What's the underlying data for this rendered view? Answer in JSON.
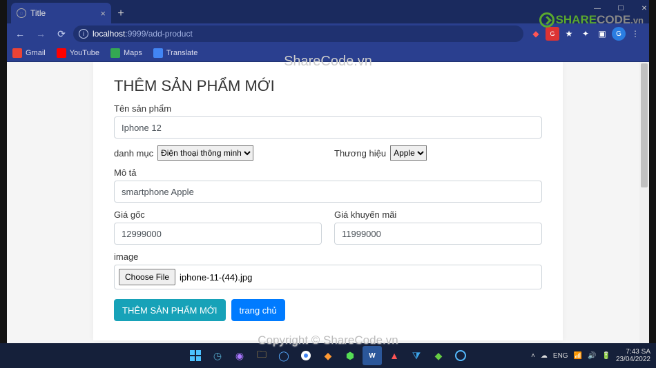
{
  "window": {
    "min": "—",
    "max": "☐",
    "close": "✕"
  },
  "chrome": {
    "tab_title": "Title",
    "url_host": "localhost",
    "url_port_path": ":9999/add-product",
    "bookmarks": [
      {
        "label": "Gmail",
        "color": "#ea4335"
      },
      {
        "label": "YouTube",
        "color": "#ff0000"
      },
      {
        "label": "Maps",
        "color": "#34a853"
      },
      {
        "label": "Translate",
        "color": "#4285f4"
      }
    ],
    "ext_colors": [
      "#d33",
      "#e55",
      "#fff",
      "#fff",
      "#fff",
      "#2a7de1"
    ]
  },
  "page": {
    "heading": "THÊM SẢN PHẨM MỚI",
    "name_label": "Tên sản phẩm",
    "name_value": "Iphone 12",
    "category_label": "danh mục",
    "category_value": "Điện thoại thông minh",
    "brand_label": "Thương hiệu",
    "brand_value": "Apple",
    "desc_label": "Mô tả",
    "desc_value": "smartphone Apple",
    "orig_price_label": "Giá gốc",
    "orig_price_value": "12999000",
    "promo_price_label": "Giá khuyến mãi",
    "promo_price_value": "11999000",
    "image_label": "image",
    "choose_file": "Choose File",
    "file_name": "iphone-11-(44).jpg",
    "submit": "THÊM SẢN PHẨM MỚI",
    "home": "trang chủ"
  },
  "watermark": {
    "top": "ShareCode.vn",
    "bottom": "Copyright © ShareCode.vn",
    "logo_s": "SHARE",
    "logo_c": "CODE",
    "logo_vn": ".vn"
  },
  "taskbar": {
    "lang": "ENG",
    "time": "7:43 SA",
    "date": "23/04/2022"
  }
}
